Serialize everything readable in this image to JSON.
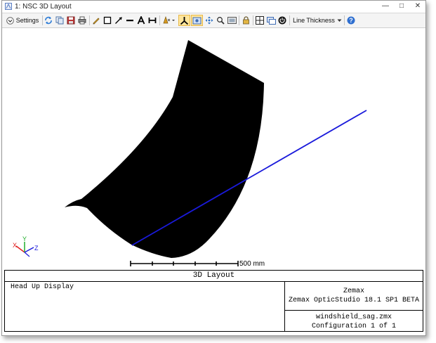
{
  "window": {
    "title": "1: NSC 3D Layout",
    "controls": [
      "minimize-icon",
      "maximize-icon",
      "close-icon"
    ]
  },
  "toolbar": {
    "settings_label": "Settings",
    "line_thickness_label": "Line Thickness",
    "icons": [
      "refresh-icon",
      "copy-icon",
      "save-icon",
      "print-icon",
      "pencil-icon",
      "rectangle-icon",
      "arrow-icon",
      "line-icon",
      "text-icon",
      "dimension-icon",
      "rotate-icon",
      "axis-icon",
      "fit-icon",
      "zoom-icon",
      "pan-icon",
      "image-icon",
      "lock-icon",
      "layout-icon",
      "window-icon",
      "power-icon",
      "help-icon"
    ]
  },
  "layout": {
    "colors": {
      "surface": "#000000",
      "ray": "#1a1adb",
      "axis_x": "#e02020",
      "axis_y": "#1fae2a",
      "axis_z": "#1a1adb",
      "active_tool": "#ffe59b"
    },
    "axes": {
      "x": "X",
      "y": "Y",
      "z": "Z"
    },
    "scale_bar": "500 mm"
  },
  "footer": {
    "caption": "3D Layout",
    "description": "Head Up Display",
    "company": "Zemax",
    "software": "Zemax OpticStudio 18.1 SP1 BETA",
    "file": "windshield_sag.zmx",
    "configuration": "Configuration 1 of 1"
  }
}
